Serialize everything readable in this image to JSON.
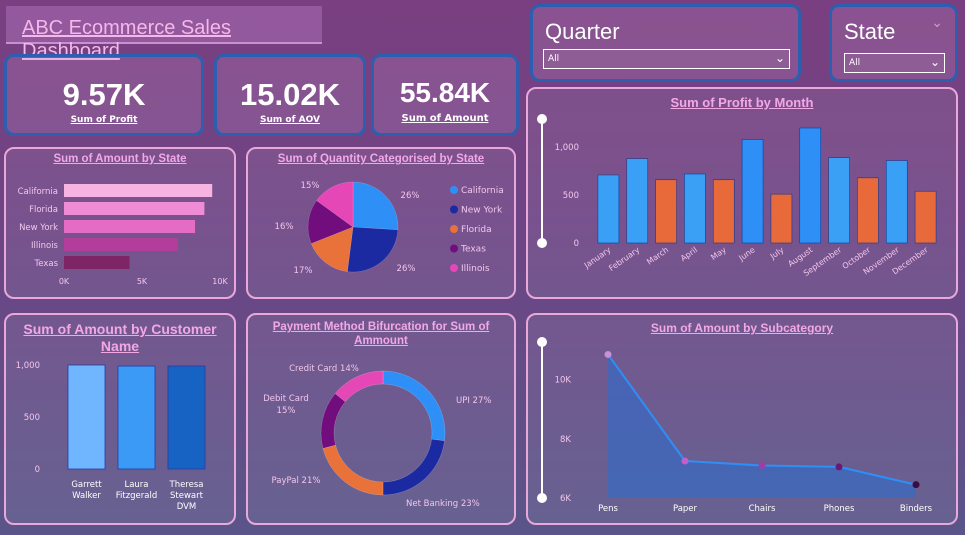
{
  "header": {
    "title": "ABC Ecommerce Sales Dashboard"
  },
  "kpis": [
    {
      "value": "9.57K",
      "label": "Sum of Profit"
    },
    {
      "value": "15.02K",
      "label": "Sum of AOV"
    },
    {
      "value": "55.84K",
      "label": "Sum of Amount"
    }
  ],
  "slicers": {
    "quarter": {
      "title": "Quarter",
      "value": "All"
    },
    "state": {
      "title": "State",
      "value": "All"
    }
  },
  "colors": {
    "pink_title": "#f3a8e6",
    "panel_border": "#e8a8da",
    "kpi_border": "#2d5fb0",
    "blue": "#2e95f5",
    "orange": "#e8693a",
    "navy": "#15289a",
    "purple": "#6e0f79",
    "magenta": "#e545b6"
  },
  "chart_data": [
    {
      "id": "amount_by_state",
      "type": "bar",
      "orientation": "horizontal",
      "title": "Sum of Amount by State",
      "categories": [
        "California",
        "Florida",
        "New York",
        "Illinois",
        "Texas"
      ],
      "values": [
        9500,
        9000,
        8400,
        7300,
        4200
      ],
      "xticks": [
        "0K",
        "5K",
        "10K"
      ],
      "xlim": [
        0,
        10000
      ],
      "bar_colors": [
        "#f7b4e2",
        "#f08cd5",
        "#e46cc5",
        "#b33d9a",
        "#7e2566"
      ]
    },
    {
      "id": "quantity_by_state",
      "type": "pie",
      "title": "Sum of Quantity Categorised by State",
      "labels": [
        "California",
        "New York",
        "Florida",
        "Texas",
        "Illinois"
      ],
      "values": [
        26,
        26,
        17,
        16,
        15
      ],
      "slice_labels": [
        "26%",
        "26%",
        "17%",
        "16%",
        "15%"
      ],
      "colors": [
        "#2e8ff7",
        "#1b2aa0",
        "#e8723a",
        "#720d7d",
        "#e547b6"
      ],
      "legend_position": "right"
    },
    {
      "id": "profit_by_month",
      "type": "bar",
      "title": "Sum of Profit by Month",
      "categories": [
        "January",
        "February",
        "March",
        "April",
        "May",
        "June",
        "July",
        "August",
        "September",
        "October",
        "November",
        "December"
      ],
      "values": [
        710,
        880,
        660,
        720,
        660,
        1080,
        510,
        1200,
        890,
        680,
        860,
        540
      ],
      "yticks": [
        "0",
        "500",
        "1,000"
      ],
      "ylim": [
        0,
        1200
      ],
      "bar_colors": [
        "#3aa0f5",
        "#3aa0f5",
        "#e8693a",
        "#3aa0f5",
        "#e8693a",
        "#2e8ff7",
        "#e8693a",
        "#2e8ff7",
        "#3aa0f5",
        "#e8693a",
        "#3aa0f5",
        "#e8693a"
      ]
    },
    {
      "id": "amount_by_customer",
      "type": "bar",
      "title": "Sum of Amount by Customer Name",
      "categories": [
        "Garrett Walker",
        "Laura Fitzgerald",
        "Theresa Stewart DVM"
      ],
      "category_lines": [
        [
          "Garrett",
          "Walker"
        ],
        [
          "Laura",
          "Fitzgerald"
        ],
        [
          "Theresa",
          "Stewart",
          "DVM"
        ]
      ],
      "values": [
        1000,
        990,
        990
      ],
      "yticks": [
        "0",
        "500",
        "1,000"
      ],
      "ylim": [
        0,
        1000
      ],
      "bar_colors": [
        "#6fb6ff",
        "#3a9af5",
        "#1763c4"
      ]
    },
    {
      "id": "payment_method",
      "type": "pie",
      "variant": "donut",
      "title": "Payment Method Bifurcation for Sum of Ammount",
      "labels": [
        "UPI",
        "Net Banking",
        "PayPal",
        "Debit Card",
        "Credit Card"
      ],
      "values": [
        27,
        23,
        21,
        15,
        14
      ],
      "slice_labels": [
        "UPI 27%",
        "Net Banking 23%",
        "PayPal 21%",
        "Debit Card 15%",
        "Credit Card 14%"
      ],
      "colors": [
        "#2e8ff7",
        "#1b2aa0",
        "#e8723a",
        "#720d7d",
        "#e547b6"
      ]
    },
    {
      "id": "amount_by_subcategory",
      "type": "area",
      "title": "Sum of Amount by Subcategory",
      "categories": [
        "Pens",
        "Paper",
        "Chairs",
        "Phones",
        "Binders"
      ],
      "values": [
        10850,
        7250,
        7100,
        7050,
        6450
      ],
      "yticks": [
        "6K",
        "8K",
        "10K"
      ],
      "ylim": [
        6000,
        11000
      ],
      "marker_colors": [
        "#c890d8",
        "#c060c8",
        "#a03ca8",
        "#6a1a74",
        "#3a0c44"
      ]
    }
  ]
}
